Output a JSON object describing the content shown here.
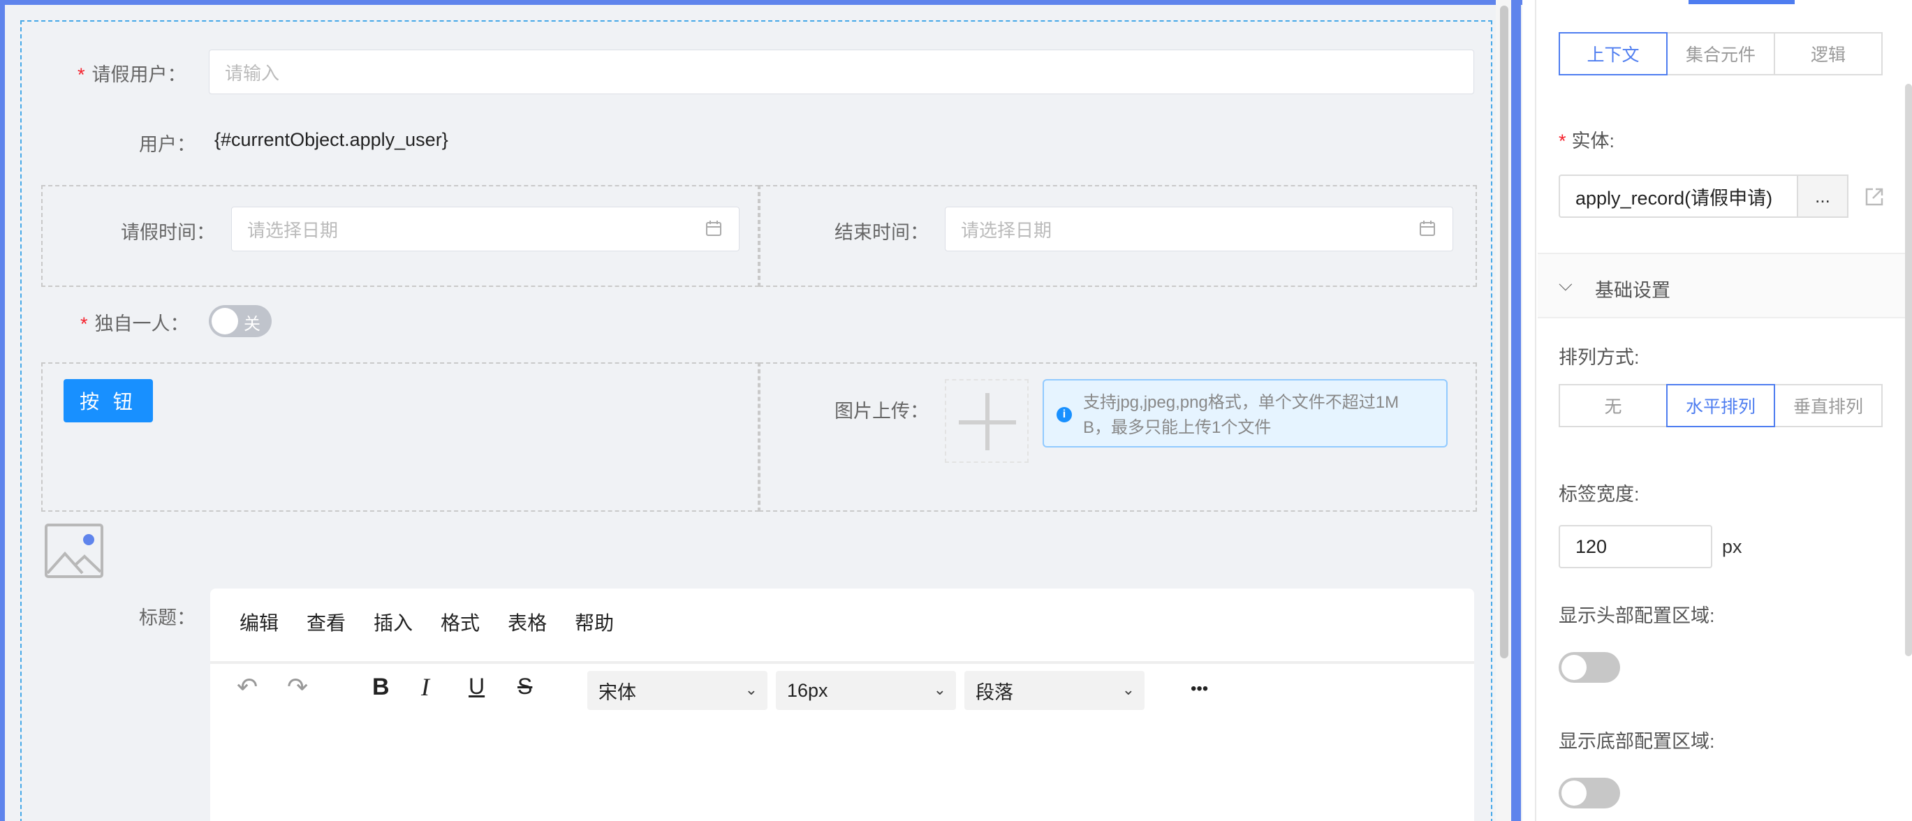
{
  "form": {
    "leave_user": {
      "label": "请假用户：",
      "placeholder": "请输入"
    },
    "user": {
      "label": "用户：",
      "value": "{#currentObject.apply_user}"
    },
    "leave_time": {
      "label": "请假时间：",
      "placeholder": "请选择日期"
    },
    "end_time": {
      "label": "结束时间：",
      "placeholder": "请选择日期"
    },
    "alone": {
      "label": "独自一人：",
      "switch_text": "关"
    },
    "button_label": "按 钮",
    "image_upload": {
      "label": "图片上传：",
      "hint_line1": "支持jpg,jpeg,png格式，单个文件不超过1M",
      "hint_line2": "B，最多只能上传1个文件"
    },
    "title": {
      "label": "标题："
    },
    "required_mark": "*"
  },
  "editor": {
    "menus": [
      "编辑",
      "查看",
      "插入",
      "格式",
      "表格",
      "帮助"
    ],
    "font_family": "宋体",
    "font_size": "16px",
    "block": "段落",
    "more": "•••"
  },
  "panel": {
    "source_tabs": [
      "上下文",
      "集合元件",
      "逻辑"
    ],
    "source_active": "上下文",
    "entity_label": "实体:",
    "entity_value": "apply_record(请假申请)",
    "entity_more": "...",
    "section_title": "基础设置",
    "arrange_label": "排列方式:",
    "arrange_options": [
      "无",
      "水平排列",
      "垂直排列"
    ],
    "arrange_active": "水平排列",
    "label_width_label": "标签宽度:",
    "label_width_value": "120",
    "label_width_unit": "px",
    "show_header_label": "显示头部配置区域:",
    "show_footer_label": "显示底部配置区域:",
    "show_header_on": false,
    "show_footer_on": false
  },
  "colors": {
    "accent": "#4e7df0",
    "primary_button": "#1890ff",
    "required": "#f5222d",
    "selection": "#5f84ec"
  }
}
